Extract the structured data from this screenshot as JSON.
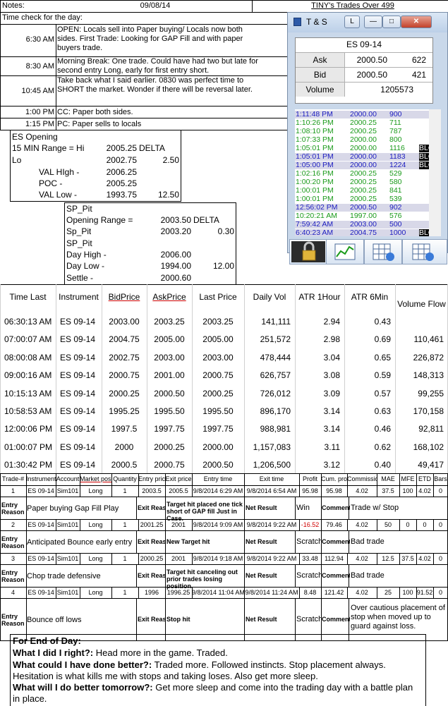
{
  "header": {
    "notes_label": "Notes:",
    "date": "09/08/14",
    "title": "TINY's Trades Over 499",
    "time_check": "Time check for the day:"
  },
  "timeline": [
    {
      "time": "6:30 AM",
      "note": "OPEN: Locals sell into Paper buying/ Locals now both sides.  First Trade: Looking for GAP Fill and with paper buyers trade."
    },
    {
      "time": "8:30 AM",
      "note": "Morning Break: One trade. Could have had two but late for second entry Long, early for first entry short."
    },
    {
      "time": "10:45 AM",
      "note": "Take back what I said earlier.  0830 was perfect time to SHORT the market.  Wonder if there will be reversal later."
    },
    {
      "time": "1:00 PM",
      "note": "CC: Paper both sides."
    },
    {
      "time": "1:15 PM",
      "note": "PC: Paper sells to locals"
    }
  ],
  "es_opening": {
    "title": "ES Opening",
    "range_label": "15 MIN Range = Hi",
    "hi": "2005.25",
    "delta_label": "DELTA",
    "lo_label": "Lo",
    "lo": "2002.75",
    "delta": "2.50",
    "val_high_label": "VAL HIgh  -",
    "val_high": "2006.25",
    "poc_label": "POC  -",
    "poc": "2005.25",
    "val_low_label": "VAL Low  -",
    "val_low": "1993.75",
    "val_delta": "12.50"
  },
  "sp_pit": {
    "title1": "SP_Pit",
    "opening_range_label": "Opening Range =",
    "opening_range": "2003.50",
    "delta_label": "DELTA",
    "sp_pit_label": "Sp_Pit",
    "sp_pit": "2003.20",
    "delta": "0.30",
    "title2": "SP_Pit",
    "day_high_label": "Day High -",
    "day_high": "2006.00",
    "day_low_label": "Day Low -",
    "day_low": "1994.00",
    "day_delta": "12.00",
    "settle_label": "Settle -",
    "settle": "2000.60"
  },
  "ts_window": {
    "title": "T & S",
    "l_button": "L",
    "symbol": "ES 09-14",
    "ask_label": "Ask",
    "ask": "2000.50",
    "ask_size": "622",
    "bid_label": "Bid",
    "bid": "2000.50",
    "bid_size": "421",
    "volume_label": "Volume",
    "volume": "1205573",
    "colors": {
      "green": "#1a9a1a",
      "blue": "#2020c0",
      "block_bg": "#000000",
      "selected_bg": "#d8d8e8"
    },
    "tape": [
      {
        "time": "1:11:48 PM",
        "price": "2000.00",
        "size": "900",
        "color": "blue",
        "flag": "",
        "shaded": true
      },
      {
        "time": "1:10:26 PM",
        "price": "2000.25",
        "size": "711",
        "color": "green",
        "flag": "",
        "shaded": false
      },
      {
        "time": "1:08:10 PM",
        "price": "2000.25",
        "size": "787",
        "color": "green",
        "flag": "",
        "shaded": false
      },
      {
        "time": "1:07:33 PM",
        "price": "2000.00",
        "size": "800",
        "color": "green",
        "flag": "",
        "shaded": false
      },
      {
        "time": "1:05:01 PM",
        "price": "2000.00",
        "size": "1116",
        "color": "green",
        "flag": "BLO",
        "shaded": false
      },
      {
        "time": "1:05:01 PM",
        "price": "2000.00",
        "size": "1183",
        "color": "blue",
        "flag": "BLO",
        "shaded": true
      },
      {
        "time": "1:05:00 PM",
        "price": "2000.00",
        "size": "1224",
        "color": "blue",
        "flag": "BLO",
        "shaded": true
      },
      {
        "time": "1:02:16 PM",
        "price": "2000.25",
        "size": "529",
        "color": "green",
        "flag": "",
        "shaded": false
      },
      {
        "time": "1:00:20 PM",
        "price": "2000.25",
        "size": "580",
        "color": "green",
        "flag": "",
        "shaded": false
      },
      {
        "time": "1:00:01 PM",
        "price": "2000.25",
        "size": "841",
        "color": "green",
        "flag": "",
        "shaded": false
      },
      {
        "time": "1:00:01 PM",
        "price": "2000.25",
        "size": "539",
        "color": "green",
        "flag": "",
        "shaded": false
      },
      {
        "time": "12:56:02 PM",
        "price": "2000.50",
        "size": "902",
        "color": "blue",
        "flag": "",
        "shaded": true
      },
      {
        "time": "10:20:21 AM",
        "price": "1997.00",
        "size": "576",
        "color": "green",
        "flag": "",
        "shaded": false
      },
      {
        "time": "7:59:42 AM",
        "price": "2003.00",
        "size": "500",
        "color": "blue",
        "flag": "",
        "shaded": true
      },
      {
        "time": "6:40:23 AM",
        "price": "2004.75",
        "size": "1000",
        "color": "blue",
        "flag": "BLO",
        "shaded": true
      }
    ],
    "toolbar_icons": [
      "lock-icon",
      "chart-icon",
      "grid-refresh-icon",
      "grid-refresh-icon-2"
    ]
  },
  "market_table": {
    "headers": [
      "Time Last",
      "Instrument",
      "BidPrice",
      "AskPrice",
      "Last Price",
      "Daily Vol",
      "ATR 1Hour",
      "ATR 6Min",
      "Volume Flow"
    ],
    "rows": [
      [
        "06:30:13 AM",
        "ES 09-14",
        "2003.00",
        "2003.25",
        "2003.25",
        "141,111",
        "2.94",
        "0.43",
        ""
      ],
      [
        "07:00:07 AM",
        "ES 09-14",
        "2004.75",
        "2005.00",
        "2005.00",
        "251,572",
        "2.98",
        "0.69",
        "110,461"
      ],
      [
        "08:00:08 AM",
        "ES 09-14",
        "2002.75",
        "2003.00",
        "2003.00",
        "478,444",
        "3.04",
        "0.65",
        "226,872"
      ],
      [
        "09:00:16 AM",
        "ES 09-14",
        "2000.75",
        "2001.00",
        "2000.75",
        "626,757",
        "3.08",
        "0.59",
        "148,313"
      ],
      [
        "10:15:13 AM",
        "ES 09-14",
        "2000.25",
        "2000.50",
        "2000.25",
        "726,012",
        "3.09",
        "0.57",
        "99,255"
      ],
      [
        "10:58:53 AM",
        "ES 09-14",
        "1995.25",
        "1995.50",
        "1995.50",
        "896,170",
        "3.14",
        "0.63",
        "170,158"
      ],
      [
        "12:00:06 PM",
        "ES 09-14",
        "1997.5",
        "1997.75",
        "1997.75",
        "988,981",
        "3.14",
        "0.46",
        "92,811"
      ],
      [
        "01:00:07 PM",
        "ES 09-14",
        "2000",
        "2000.25",
        "2000.00",
        "1,157,083",
        "3.11",
        "0.62",
        "168,102"
      ],
      [
        "01:30:42 PM",
        "ES 09-14",
        "2000.5",
        "2000.75",
        "2000.50",
        "1,206,500",
        "3.12",
        "0.40",
        "49,417"
      ]
    ]
  },
  "trades": {
    "headers": [
      "Trade-#",
      "Instrument",
      "Account",
      "Market pos.",
      "Quantity",
      "Entry price",
      "Exit price",
      "Entry time",
      "Exit time",
      "Profit",
      "Cum. profit",
      "Commission",
      "MAE",
      "MFE",
      "ETD",
      "Bars"
    ],
    "entry_reason_label": "Entry Reason",
    "exit_reason_label": "Exit Reason",
    "net_result_label": "Net Result",
    "comment_label": "Comment",
    "rows": [
      {
        "cells": [
          "1",
          "ES 09-14",
          "Sim101",
          "Long",
          "1",
          "2003.5",
          "2005.5",
          "9/8/2014 6:29 AM",
          "9/8/2014 6:54 AM",
          "95.98",
          "95.98",
          "4.02",
          "37.5",
          "100",
          "4.02",
          "0"
        ],
        "entry_reason": "Paper buying Gap Fill Play",
        "exit_reason": "Target hit placed one tick short of GAP fill Just in Case.",
        "net_result": "Win",
        "comment": "Trade w/ Stop"
      },
      {
        "cells": [
          "2",
          "ES 09-14",
          "Sim101",
          "Long",
          "1",
          "2001.25",
          "2001",
          "9/8/2014 9:09 AM",
          "9/8/2014 9:22 AM",
          "-16.52",
          "79.46",
          "4.02",
          "50",
          "0",
          "0",
          "0"
        ],
        "entry_reason": "Anticipated Bounce early entry",
        "exit_reason": "New Target hit",
        "net_result": "Scratch",
        "comment": "Bad trade"
      },
      {
        "cells": [
          "3",
          "ES 09-14",
          "Sim101",
          "Long",
          "1",
          "2000.25",
          "2001",
          "9/8/2014 9:18 AM",
          "9/8/2014 9:22 AM",
          "33.48",
          "112.94",
          "4.02",
          "12.5",
          "37.5",
          "4.02",
          "0"
        ],
        "entry_reason": "Chop trade defensive",
        "exit_reason": "Target hit canceling out prior trades losing position.",
        "net_result": "Scratch",
        "comment": "Bad trade"
      },
      {
        "cells": [
          "4",
          "ES 09-14",
          "Sim101",
          "Long",
          "1",
          "1996",
          "1996.25",
          "9/8/2014 11:04 AM",
          "9/8/2014 11:24 AM",
          "8.48",
          "121.42",
          "4.02",
          "25",
          "100",
          "91.52",
          "0"
        ],
        "entry_reason": "Bounce off lows",
        "exit_reason": "Stop hit",
        "net_result": "Scratch",
        "comment": "Over cautious placement of stop when moved up to guard against loss."
      }
    ]
  },
  "end_of_day": {
    "title": "For End of Day:",
    "right_q": "What I did I right?:",
    "right_a": "Head more in the game.  Traded.",
    "better_q": "What could I have done better?:",
    "better_a": "Traded more.  Followed instincts.  Stop placement always.",
    "better_a2": "Hesitation is what kills me with stops and taking loses.  Also get more sleep.",
    "tomorrow_q": "What will I do better tomorrow?:",
    "tomorrow_a": "Get more sleep and come into the trading day with a battle plan in place."
  }
}
